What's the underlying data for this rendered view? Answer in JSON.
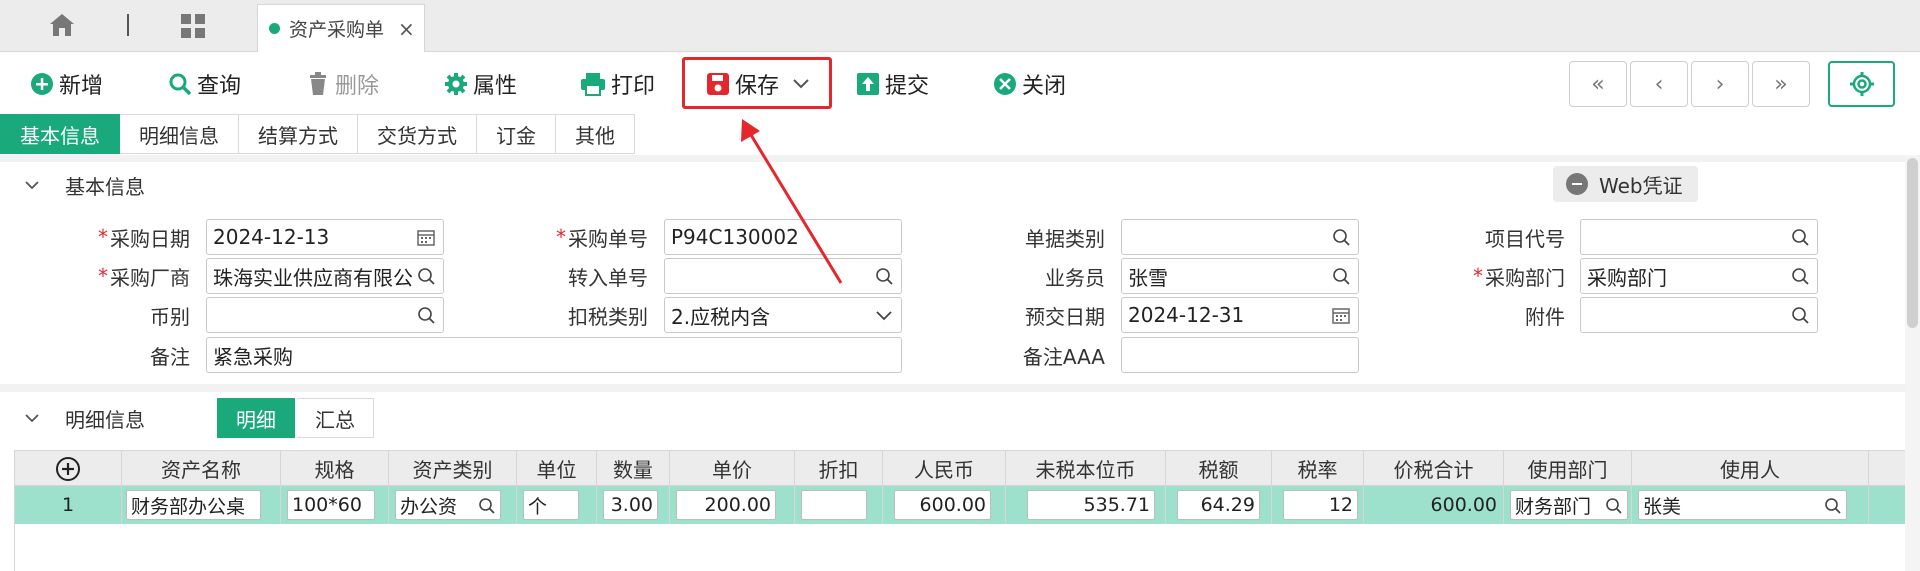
{
  "tabs": {
    "doc_tab": "资产采购单",
    "close": "×"
  },
  "toolbar": {
    "add": "新增",
    "query": "查询",
    "delete": "删除",
    "props": "属性",
    "print": "打印",
    "save": "保存",
    "submit": "提交",
    "close": "关闭",
    "nav": [
      "«",
      "‹",
      "›",
      "»"
    ]
  },
  "section_tabs": [
    "基本信息",
    "明细信息",
    "结算方式",
    "交货方式",
    "订金",
    "其他"
  ],
  "basic": {
    "title": "基本信息",
    "web_voucher": "Web凭证",
    "fields": {
      "purchase_date": {
        "label": "采购日期",
        "value": "2024-12-13"
      },
      "purchase_no": {
        "label": "采购单号",
        "value": "P94C130002"
      },
      "doc_type": {
        "label": "单据类别",
        "value": ""
      },
      "project_code": {
        "label": "项目代号",
        "value": ""
      },
      "vendor": {
        "label": "采购厂商",
        "value": "珠海实业供应商有限公"
      },
      "transfer_no": {
        "label": "转入单号",
        "value": ""
      },
      "salesman": {
        "label": "业务员",
        "value": "张雪"
      },
      "dept": {
        "label": "采购部门",
        "value": "采购部门"
      },
      "currency": {
        "label": "币别",
        "value": ""
      },
      "tax_type": {
        "label": "扣税类别",
        "value": "2.应税内含"
      },
      "delivery_date": {
        "label": "预交日期",
        "value": "2024-12-31"
      },
      "attachment": {
        "label": "附件",
        "value": ""
      },
      "remark": {
        "label": "备注",
        "value": "紧急采购"
      },
      "remark_aaa": {
        "label": "备注AAA",
        "value": ""
      }
    }
  },
  "detail": {
    "title": "明细信息",
    "subtabs": [
      "明细",
      "汇总"
    ],
    "columns": [
      "资产名称",
      "规格",
      "资产类别",
      "单位",
      "数量",
      "单价",
      "折扣",
      "人民币",
      "未税本位币",
      "税额",
      "税率",
      "价税合计",
      "使用部门",
      "使用人"
    ],
    "rows": [
      {
        "no": "1",
        "name": "财务部办公桌",
        "spec": "100*60",
        "category": "办公资",
        "unit": "个",
        "qty": "3.00",
        "price": "200.00",
        "discount": "",
        "rmb": "600.00",
        "net": "535.71",
        "tax": "64.29",
        "rate": "12",
        "total": "600.00",
        "dept": "财务部门",
        "user": "张美"
      }
    ]
  },
  "colors": {
    "accent": "#19a97b",
    "highlight_box": "#e5262d",
    "row_selected": "#9de0cb"
  }
}
